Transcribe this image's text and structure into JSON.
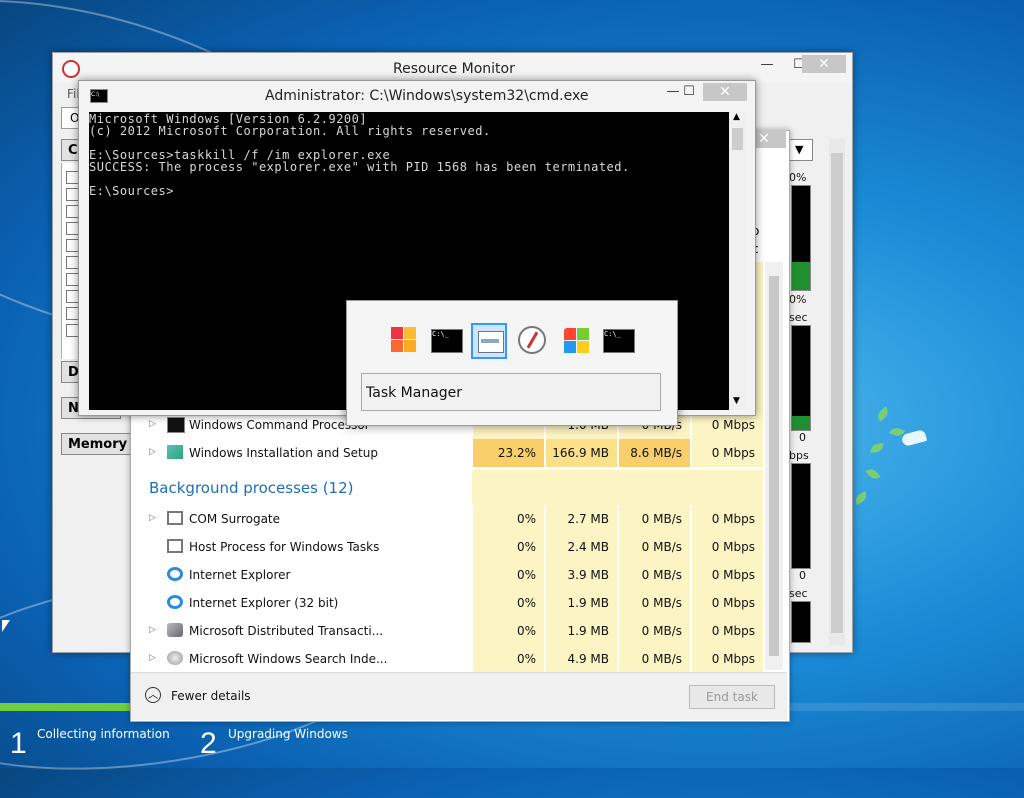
{
  "setup": {
    "progress": 0.13,
    "steps": [
      {
        "number": "1",
        "label": "Collecting information"
      },
      {
        "number": "2",
        "label": "Upgrading Windows"
      }
    ]
  },
  "resource_monitor": {
    "title": "Resource Monitor",
    "tab_fragments": [
      "Fil",
      "O",
      "C"
    ],
    "sidebar_buttons": [
      "D",
      "N",
      "Memory"
    ],
    "graph_labels": [
      "0%",
      "0%",
      "sec",
      "0",
      "bps",
      "0",
      "sec"
    ],
    "close_glyph": "✕",
    "min_glyph": "—",
    "max_glyph": "☐",
    "dropdown_glyph": "▼"
  },
  "task_manager": {
    "visible_header_fragments": [
      "o",
      "c"
    ],
    "rows_top": [
      {
        "name": "Windows Command Processor",
        "cpu": "",
        "memory": "1.0 MB",
        "disk": "0 MB/s",
        "network": "0 Mbps",
        "expander": "▷",
        "icon": "cmd-icon"
      },
      {
        "name": "Windows Installation and Setup",
        "cpu": "23.2%",
        "memory": "166.9 MB",
        "disk": "8.6 MB/s",
        "network": "0 Mbps",
        "expander": "▷",
        "icon": "setup-icon"
      }
    ],
    "section_title": "Background processes (12)",
    "rows_background": [
      {
        "name": "COM Surrogate",
        "cpu": "0%",
        "memory": "2.7 MB",
        "disk": "0 MB/s",
        "network": "0 Mbps",
        "expander": "▷",
        "icon": "window-icon"
      },
      {
        "name": "Host Process for Windows Tasks",
        "cpu": "0%",
        "memory": "2.4 MB",
        "disk": "0 MB/s",
        "network": "0 Mbps",
        "expander": "",
        "icon": "window-icon"
      },
      {
        "name": "Internet Explorer",
        "cpu": "0%",
        "memory": "3.9 MB",
        "disk": "0 MB/s",
        "network": "0 Mbps",
        "expander": "",
        "icon": "ie-icon"
      },
      {
        "name": "Internet Explorer (32 bit)",
        "cpu": "0%",
        "memory": "1.9 MB",
        "disk": "0 MB/s",
        "network": "0 Mbps",
        "expander": "",
        "icon": "ie-icon"
      },
      {
        "name": "Microsoft Distributed Transacti...",
        "cpu": "0%",
        "memory": "1.9 MB",
        "disk": "0 MB/s",
        "network": "0 Mbps",
        "expander": "▷",
        "icon": "dtc-icon"
      },
      {
        "name": "Microsoft Windows Search Inde...",
        "cpu": "0%",
        "memory": "4.9 MB",
        "disk": "0 MB/s",
        "network": "0 Mbps",
        "expander": "▷",
        "icon": "search-index-icon"
      }
    ],
    "fewer_details": "Fewer details",
    "end_task": "End task",
    "close_glyph": "✕"
  },
  "cmd": {
    "title": "Administrator: C:\\Windows\\system32\\cmd.exe",
    "icon_text": "C:\\",
    "lines": [
      "Microsoft Windows [Version 6.2.9200]",
      "(c) 2012 Microsoft Corporation. All rights reserved.",
      "",
      "E:\\Sources>taskkill /f /im explorer.exe",
      "SUCCESS: The process \"explorer.exe\" with PID 1568 has been terminated.",
      "",
      "E:\\Sources>"
    ],
    "min_glyph": "—",
    "max_glyph": "☐",
    "close_glyph": "✕"
  },
  "switcher": {
    "caption": "Task Manager",
    "selected_index": 2,
    "icons": [
      "windows-flag-icon",
      "cmd-icon",
      "resource-monitor-icon",
      "compass-icon",
      "windows-logo-icon",
      "cmd-icon"
    ]
  }
}
